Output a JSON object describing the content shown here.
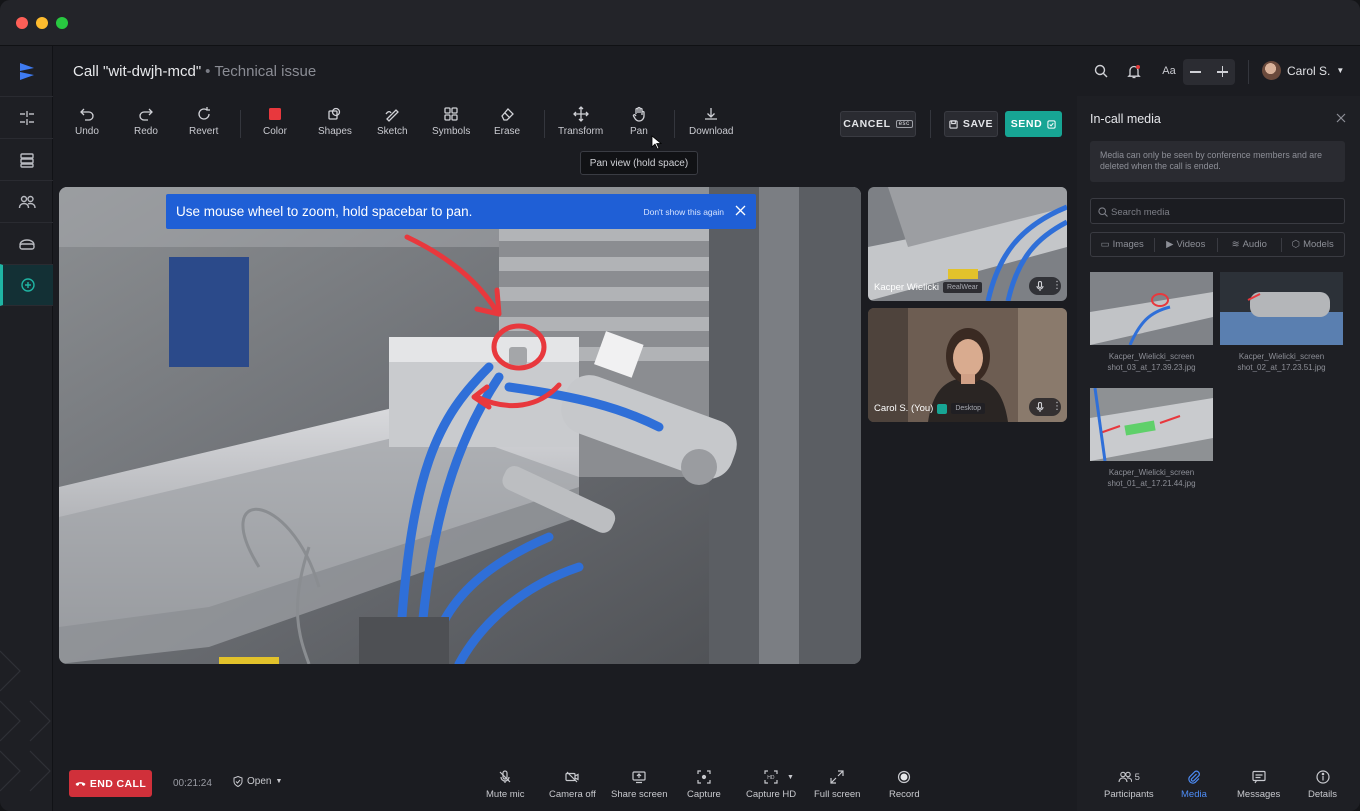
{
  "window": {
    "title": "Call \"wit-dwjh-mcd\"",
    "subtitle": "Technical issue",
    "separator": "•"
  },
  "header": {
    "user_name": "Carol S.",
    "font_size_label": "Aa"
  },
  "toolbar": {
    "tools": [
      "Undo",
      "Redo",
      "Revert",
      "Color",
      "Shapes",
      "Sketch",
      "Symbols",
      "Erase",
      "Transform",
      "Pan",
      "Download"
    ],
    "cancel_label": "CANCEL",
    "cancel_key": "esc",
    "save_label": "SAVE",
    "send_label": "SEND",
    "tooltip": "Pan view (hold space)",
    "accent_color": "#17a594",
    "annotation_color": "#e8383d"
  },
  "banner": {
    "message": "Use mouse wheel to zoom, hold spacebar to pan.",
    "dismiss": "Don't show this again"
  },
  "participants_video": [
    {
      "name": "Kacper Wielicki",
      "device": "RealWear"
    },
    {
      "name": "Carol S. (You)",
      "device": "Desktop"
    }
  ],
  "panel": {
    "title": "In-call media",
    "notice": "Media can only be seen by conference members and are deleted when the call is ended.",
    "search_placeholder": "Search media",
    "tabs": [
      "Images",
      "Videos",
      "Audio",
      "Models"
    ],
    "media": [
      {
        "file": "Kacper_Wielicki_screen shot_03_at_17.39.23.jpg"
      },
      {
        "file": "Kacper_Wielicki_screen shot_02_at_17.23.51.jpg"
      },
      {
        "file": "Kacper_Wielicki_screen shot_01_at_17.21.44.jpg"
      }
    ]
  },
  "bottom": {
    "end_call": "END CALL",
    "timer": "00:21:24",
    "status": "Open",
    "controls": [
      "Mute mic",
      "Camera off",
      "Share screen",
      "Capture",
      "Capture HD",
      "Full screen",
      "Record"
    ],
    "nav": [
      "Participants",
      "Media",
      "Messages",
      "Details"
    ],
    "participants_count": "5"
  }
}
